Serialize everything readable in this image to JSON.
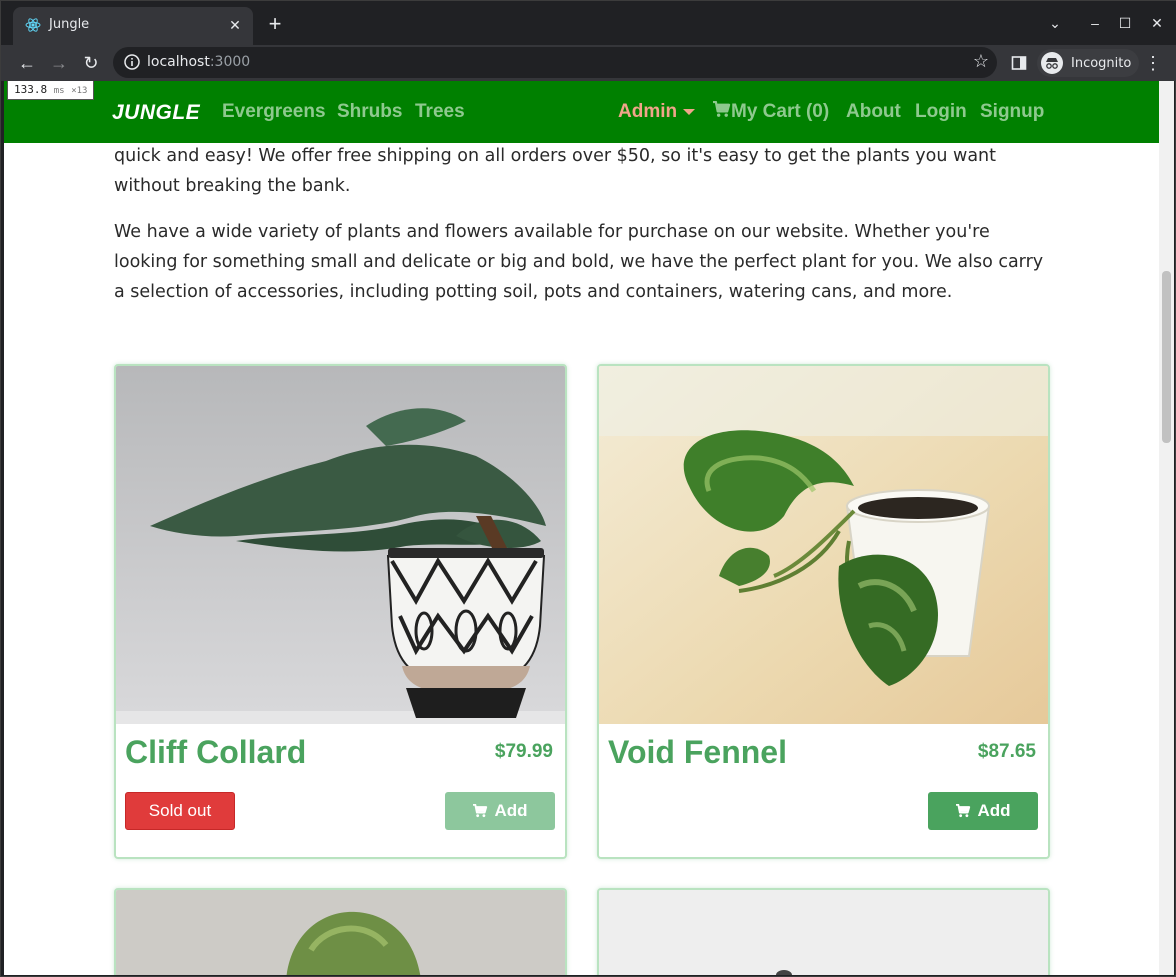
{
  "browser": {
    "tab_title": "Jungle",
    "url_host": "localhost",
    "url_port": ":3000",
    "incognito_label": "Incognito"
  },
  "perf_overlay": {
    "time": "133.8",
    "unit": "ms",
    "count": "×13"
  },
  "nav": {
    "brand": "JUNGLE",
    "links": [
      "Evergreens",
      "Shrubs",
      "Trees"
    ],
    "admin": "Admin",
    "cart": "My Cart (0)",
    "about": "About",
    "login": "Login",
    "signup": "Signup"
  },
  "intro": {
    "p1": "quick and easy! We offer free shipping on all orders over $50, so it's easy to get the plants you want without breaking the bank.",
    "p2": "We have a wide variety of plants and flowers available for purchase on our website. Whether you're looking for something small and delicate or big and bold, we have the perfect plant for you. We also carry a selection of accessories, including potting soil, pots and containers, watering cans, and more."
  },
  "products": [
    {
      "name": "Cliff Collard",
      "price": "$79.99",
      "sold_out_label": "Sold out",
      "add_label": "Add",
      "sold_out": true
    },
    {
      "name": "Void Fennel",
      "price": "$87.65",
      "add_label": "Add",
      "sold_out": false
    }
  ],
  "colors": {
    "navbar": "#008000",
    "accent": "#4aa35e",
    "sold_out": "#e03b3b"
  },
  "icons": [
    "react-favicon",
    "info-icon",
    "star-icon",
    "sidebar-icon",
    "incognito-icon",
    "cart-icon"
  ]
}
